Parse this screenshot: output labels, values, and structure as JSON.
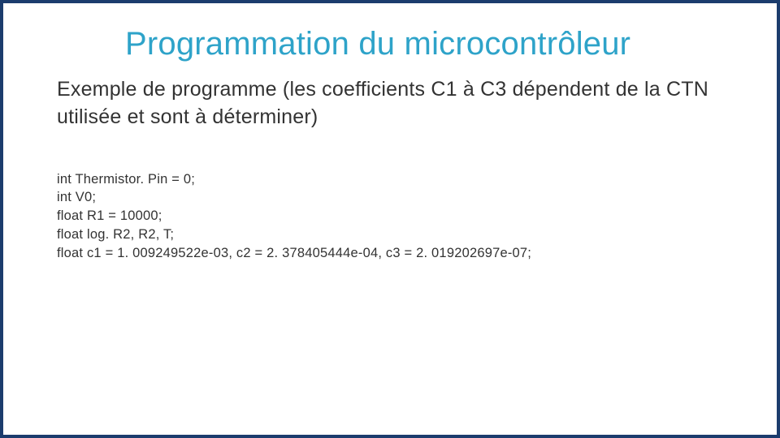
{
  "title": "Programmation du microcontrôleur",
  "subtitle": "Exemple de programme (les coefficients C1 à C3 dépendent de la CTN utilisée et sont à déterminer)",
  "code": {
    "line1": "int Thermistor. Pin = 0;",
    "line2": "int V0;",
    "line3": "float R1 = 10000;",
    "line4": "float log. R2, R2, T;",
    "line5": "float c1 = 1. 009249522e-03, c2 = 2. 378405444e-04, c3 = 2. 019202697e-07;"
  }
}
